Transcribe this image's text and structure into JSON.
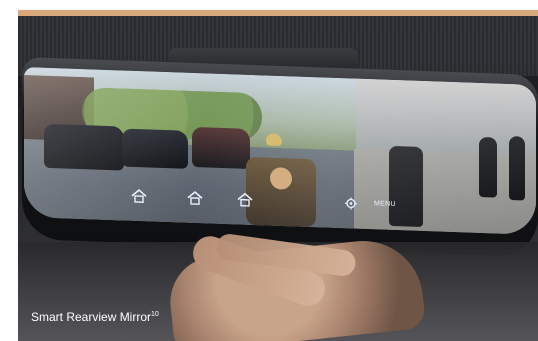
{
  "mirror": {
    "menu_label": "MENU",
    "button_icons": [
      "home-icon",
      "home-icon",
      "home-icon",
      "settings-icon"
    ]
  },
  "caption": {
    "text": "Smart Rearview Mirror",
    "superscript": "10"
  },
  "colors": {
    "caption_text": "#ffffff",
    "top_strip": "#d9a77a"
  }
}
